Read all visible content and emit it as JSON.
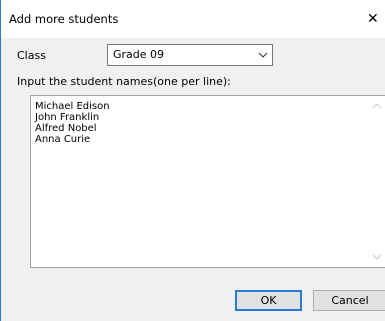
{
  "window": {
    "title": "Add more students",
    "close_icon": "close-icon"
  },
  "form": {
    "class_label": "Class",
    "class_value": "Grade 09",
    "names_label": "Input the student names(one per line):",
    "names_text": "Michael Edison\nJohn Franklin\nAlfred Nobel\nAnna Curie"
  },
  "buttons": {
    "ok_label": "OK",
    "cancel_label": "Cancel"
  },
  "colors": {
    "accent": "#2a7bd4",
    "dialog_background": "#f0f0f0"
  }
}
